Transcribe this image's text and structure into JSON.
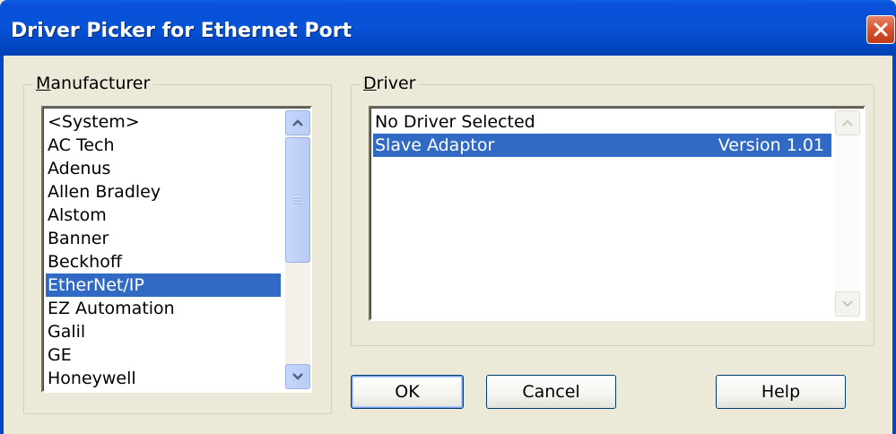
{
  "window": {
    "title": "Driver Picker for Ethernet Port"
  },
  "manufacturer": {
    "legend_mnemonic": "M",
    "legend_rest": "anufacturer",
    "items": [
      "<System>",
      "AC Tech",
      "Adenus",
      "Allen Bradley",
      "Alstom",
      "Banner",
      "Beckhoff",
      "EtherNet/IP",
      "EZ Automation",
      "Galil",
      "GE",
      "Honeywell"
    ],
    "selected_index": 7
  },
  "driver": {
    "legend_mnemonic": "D",
    "legend_rest": "river",
    "items": [
      {
        "name": "No Driver Selected",
        "version": ""
      },
      {
        "name": "Slave Adaptor",
        "version": "Version 1.01"
      }
    ],
    "selected_index": 1
  },
  "buttons": {
    "ok": "OK",
    "cancel": "Cancel",
    "help": "Help"
  },
  "colors": {
    "selection": "#316ac5",
    "titlebar": "#0753d8",
    "dialog_bg": "#ece9d8"
  },
  "icons": {
    "close": "close-icon",
    "scroll_up": "scroll-up-arrow-icon",
    "scroll_down": "scroll-down-arrow-icon",
    "scroll_grip": "scroll-grip-icon"
  }
}
